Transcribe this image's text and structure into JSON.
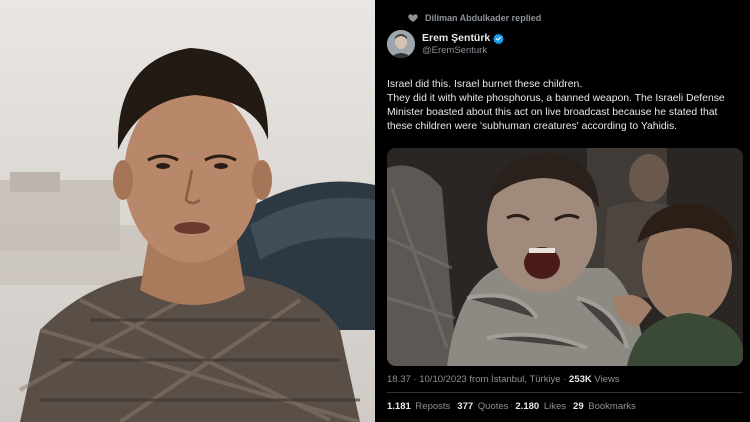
{
  "tweet": {
    "replied_by": "Diliman Abdulkader replied",
    "author": {
      "name": "Erem Şentürk",
      "handle": "@EremSenturk"
    },
    "text_lines": [
      "Israel did this. Israel burnet these children.",
      "They did it with white phosphorus, a banned weapon. The Israeli Defense",
      "Minister boasted about this act on live broadcast because he stated that",
      "these children were 'subhuman creatures' according to Yahidis."
    ],
    "meta": {
      "time": "18.37",
      "date": "10/10/2023",
      "location": "from İstanbul, Türkiye",
      "views_count": "253K",
      "views_label": "Views"
    },
    "stats": {
      "reposts": {
        "count": "1.181",
        "label": "Reposts"
      },
      "quotes": {
        "count": "377",
        "label": "Quotes"
      },
      "likes": {
        "count": "2.180",
        "label": "Likes"
      },
      "bookmarks": {
        "count": "29",
        "label": "Bookmarks"
      }
    }
  },
  "colors": {
    "background": "#000000",
    "text_primary": "#e7e9ea",
    "text_secondary": "#8b9298",
    "verified": "#1d9bf0",
    "divider": "#2f3336"
  },
  "icons": {
    "replied": "heart-reply-icon",
    "verified": "verified-badge-icon"
  }
}
